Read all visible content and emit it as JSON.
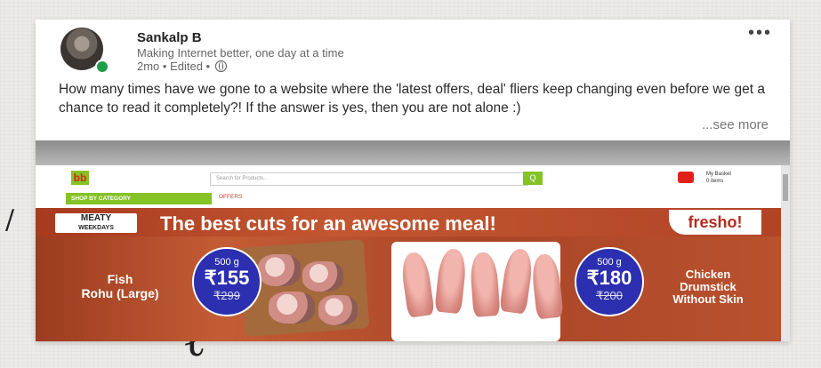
{
  "post": {
    "author_name": "Sankalp B",
    "author_tagline": "Making Internet better, one day at a time",
    "meta": "2mo • Edited •",
    "more_label": "•••",
    "text": "How many times have we gone to a website where the 'latest offers, deal' fliers keep changing even before we get a chance to read it completely?! If the answer is yes, then you are not alone :)",
    "see_more": "...see more"
  },
  "embedded_screenshot": {
    "logo": "bb",
    "search_placeholder": "Search for Products..",
    "search_button": "Q",
    "category_button": "SHOP BY CATEGORY",
    "offers_link": "OFFERS",
    "basket_label_1": "My Basket",
    "basket_label_2": "0 items",
    "banner": {
      "badge_line1": "MEATY",
      "badge_line2": "WEEKDAYS",
      "headline": "The best cuts for an awesome meal!",
      "brand": "fresho!",
      "fish": {
        "label_line1": "Fish",
        "label_line2": "Rohu (Large)",
        "weight": "500 g",
        "price": "₹155",
        "old_price": "₹299"
      },
      "chicken": {
        "label_line1": "Chicken",
        "label_line2": "Drumstick",
        "label_line3": "Without Skin",
        "weight": "500 g",
        "price": "₹180",
        "old_price": "₹200"
      }
    }
  },
  "colors": {
    "brand_green": "#84c225",
    "badge_blue": "#2c2fb0",
    "banner_red": "#b44a2a"
  }
}
